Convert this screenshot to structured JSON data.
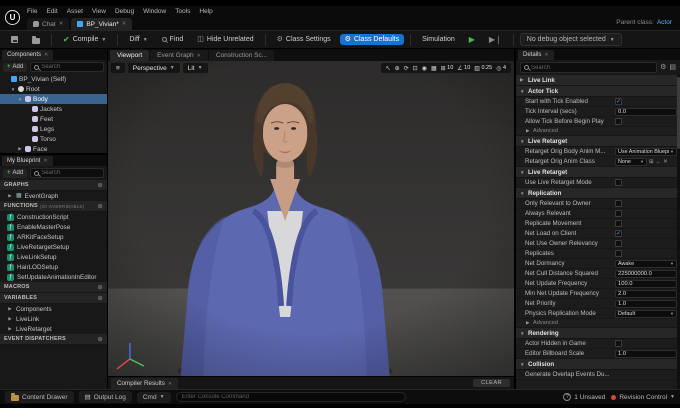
{
  "window": {
    "logo": "U",
    "menus": [
      "File",
      "Edit",
      "Asset",
      "View",
      "Debug",
      "Window",
      "Tools",
      "Help"
    ],
    "tabs": [
      {
        "label": "Chat",
        "icon": "chat",
        "active": false
      },
      {
        "label": "BP_Vivian*",
        "icon": "blueprint",
        "active": true
      }
    ],
    "parent_class_label": "Parent class:",
    "parent_class_value": "Actor"
  },
  "toolbar": {
    "compile": "Compile",
    "diff": "Diff",
    "find": "Find",
    "hide_unrelated": "Hide Unrelated",
    "class_settings": "Class Settings",
    "class_defaults": "Class Defaults",
    "simulation": "Simulation",
    "debug_dropdown": "No debug object selected"
  },
  "components_panel": {
    "title": "Components",
    "add": "Add",
    "search_placeholder": "Search",
    "tree": [
      {
        "label": "BP_Vivian (Self)",
        "indent": 0,
        "icon": "self",
        "arrow": ""
      },
      {
        "label": "Root",
        "indent": 1,
        "icon": "root",
        "arrow": "open"
      },
      {
        "label": "Body",
        "indent": 2,
        "icon": "mesh",
        "arrow": "open",
        "selected": true
      },
      {
        "label": "Jackets",
        "indent": 3,
        "icon": "mesh",
        "arrow": ""
      },
      {
        "label": "Feet",
        "indent": 3,
        "icon": "mesh",
        "arrow": ""
      },
      {
        "label": "Legs",
        "indent": 3,
        "icon": "mesh",
        "arrow": ""
      },
      {
        "label": "Torso",
        "indent": 3,
        "icon": "mesh",
        "arrow": ""
      },
      {
        "label": "Face",
        "indent": 2,
        "icon": "mesh",
        "arrow": "closed"
      }
    ]
  },
  "my_blueprint": {
    "title": "My Blueprint",
    "add": "Add",
    "search_placeholder": "Search",
    "sections": [
      {
        "label": "GRAPHS",
        "hint": "",
        "items": [
          {
            "label": "EventGraph",
            "icon": "graph",
            "arrow": "closed"
          }
        ]
      },
      {
        "label": "FUNCTIONS",
        "hint": "(20 OVERRIDABLE)",
        "items": [
          {
            "label": "ConstructionScript",
            "icon": "function",
            "arrow": ""
          },
          {
            "label": "EnableMasterPose",
            "icon": "function",
            "arrow": ""
          },
          {
            "label": "ARKitFaceSetup",
            "icon": "function",
            "arrow": ""
          },
          {
            "label": "LiveRetargetSetup",
            "icon": "function",
            "arrow": ""
          },
          {
            "label": "LiveLinkSetup",
            "icon": "function",
            "arrow": ""
          },
          {
            "label": "HairLODSetup",
            "icon": "function",
            "arrow": ""
          },
          {
            "label": "SetUpdateAnimationInEditor",
            "icon": "function",
            "arrow": ""
          }
        ]
      },
      {
        "label": "MACROS",
        "hint": "",
        "items": []
      },
      {
        "label": "VARIABLES",
        "hint": "",
        "items": [
          {
            "label": "Components",
            "icon": "category",
            "arrow": "closed"
          },
          {
            "label": "LiveLink",
            "icon": "category",
            "arrow": "closed"
          },
          {
            "label": "LiveRetarget",
            "icon": "category",
            "arrow": "closed"
          }
        ]
      },
      {
        "label": "EVENT DISPATCHERS",
        "hint": "",
        "items": []
      }
    ]
  },
  "viewport": {
    "tabs": [
      {
        "label": "Viewport",
        "active": true,
        "closable": false
      },
      {
        "label": "Event Graph",
        "active": false,
        "closable": true
      },
      {
        "label": "Construction Sc...",
        "active": false,
        "closable": false
      }
    ],
    "perspective": "Perspective",
    "lit": "Lit",
    "tools": [
      {
        "name": "select-tool",
        "glyph": "↖",
        "value": ""
      },
      {
        "name": "move-tool",
        "glyph": "⊕",
        "value": ""
      },
      {
        "name": "rotate-tool",
        "glyph": "⟳",
        "value": ""
      },
      {
        "name": "scale-tool",
        "glyph": "⊡",
        "value": ""
      },
      {
        "name": "coordinate-space-toggle",
        "glyph": "◉",
        "value": ""
      },
      {
        "name": "surface-snap-toggle",
        "glyph": "▦",
        "value": ""
      },
      {
        "name": "grid-snap-toggle",
        "glyph": "⊞",
        "value": "10"
      },
      {
        "name": "rotation-snap-toggle",
        "glyph": "∠",
        "value": "10"
      },
      {
        "name": "scale-snap-toggle",
        "glyph": "▥",
        "value": "0.25"
      },
      {
        "name": "camera-speed",
        "glyph": "◎",
        "value": "4"
      }
    ],
    "compiler_tab": "Compiler Results",
    "clear_button": "CLEAR"
  },
  "details": {
    "title": "Details",
    "search_placeholder": "Search",
    "rows": [
      {
        "t": "section",
        "label": "Live Link",
        "open": false
      },
      {
        "t": "section",
        "label": "Actor Tick",
        "open": true
      },
      {
        "t": "check",
        "label": "Start with Tick Enabled",
        "checked": true
      },
      {
        "t": "input",
        "label": "Tick Interval (secs)",
        "value": "0.0"
      },
      {
        "t": "check",
        "label": "Allow Tick Before Begin Play",
        "checked": false
      },
      {
        "t": "adv",
        "label": "Advanced"
      },
      {
        "t": "section",
        "label": "Live Retarget",
        "open": true
      },
      {
        "t": "select",
        "label": "Retarget Orig Body Anim M...",
        "value": "Use Animation Blueprint"
      },
      {
        "t": "selecticons",
        "label": "Retarget Orig Anim Class",
        "value": "None"
      },
      {
        "t": "section",
        "label": "Live Retarget",
        "open": true
      },
      {
        "t": "check",
        "label": "Use Live Retarget Mode",
        "checked": false
      },
      {
        "t": "section",
        "label": "Replication",
        "open": true
      },
      {
        "t": "check",
        "label": "Only Relevant to Owner",
        "checked": false
      },
      {
        "t": "check",
        "label": "Always Relevant",
        "checked": false
      },
      {
        "t": "check",
        "label": "Replicate Movement",
        "checked": false
      },
      {
        "t": "check",
        "label": "Net Load on Client",
        "checked": true
      },
      {
        "t": "check",
        "label": "Net Use Owner Relevancy",
        "checked": false
      },
      {
        "t": "check",
        "label": "Replicates",
        "checked": false
      },
      {
        "t": "select",
        "label": "Net Dormancy",
        "value": "Awake"
      },
      {
        "t": "input",
        "label": "Net Cull Distance Squared",
        "value": "225000000.0"
      },
      {
        "t": "input",
        "label": "Net Update Frequency",
        "value": "100.0"
      },
      {
        "t": "input",
        "label": "Min Net Update Frequency",
        "value": "2.0"
      },
      {
        "t": "input",
        "label": "Net Priority",
        "value": "1.0"
      },
      {
        "t": "select",
        "label": "Physics Replication Mode",
        "value": "Default"
      },
      {
        "t": "adv",
        "label": "Advanced"
      },
      {
        "t": "section",
        "label": "Rendering",
        "open": true
      },
      {
        "t": "check",
        "label": "Actor Hidden in Game",
        "checked": false
      },
      {
        "t": "input",
        "label": "Editor Billboard Scale",
        "value": "1.0"
      },
      {
        "t": "section",
        "label": "Collision",
        "open": true
      },
      {
        "t": "label",
        "label": "Generate Overlap Events Du..."
      }
    ]
  },
  "statusbar": {
    "content_drawer": "Content Drawer",
    "output_log": "Output Log",
    "cmd": "Cmd",
    "console_placeholder": "Enter Console Command",
    "unsaved": "1 Unsaved",
    "revision_control": "Revision Control"
  },
  "colors": {
    "accent_blue": "#1673d2",
    "selection_blue": "#38648f",
    "function_icon_teal": "#1d8a6e",
    "play_green": "#3fbf4f",
    "check_blue": "#4fa3ff"
  }
}
